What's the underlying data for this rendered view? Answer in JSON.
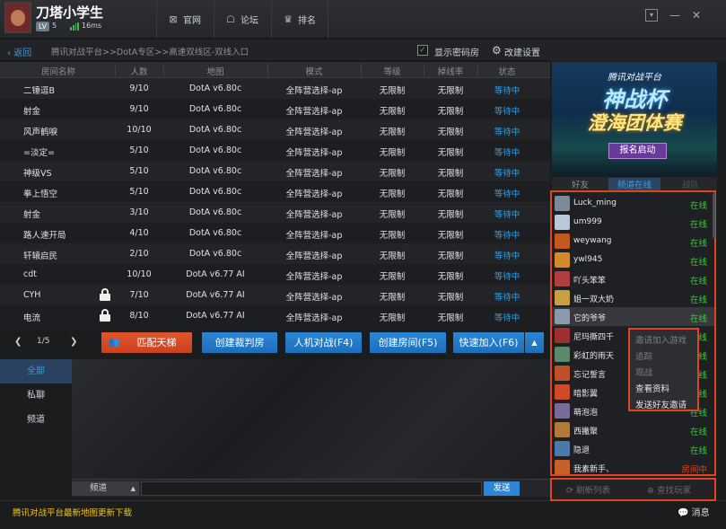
{
  "app": {
    "username": "刀塔小学生",
    "level_badge": "LV",
    "level": "5",
    "ping": "16ms",
    "nav": [
      "官网",
      "论坛",
      "排名"
    ]
  },
  "toolbar": {
    "back": "返回",
    "breadcrumb": "腾讯对战平台>>DotA专区>>高速双线区-双线入口",
    "show_password_rooms": "显示密码房",
    "edit_settings": "改建设置"
  },
  "table": {
    "headers": [
      "房间名称",
      "人数",
      "地图",
      "模式",
      "等级",
      "掉线率",
      "状态"
    ],
    "rows": [
      {
        "name": "二锤逗B",
        "count": "9/10",
        "map": "DotA v6.80c",
        "mode": "全阵营选择-ap",
        "level": "无限制",
        "drop": "无限制",
        "status": "等待中",
        "locked": false
      },
      {
        "name": "射金",
        "count": "9/10",
        "map": "DotA v6.80c",
        "mode": "全阵营选择-ap",
        "level": "无限制",
        "drop": "无限制",
        "status": "等待中",
        "locked": false
      },
      {
        "name": "风声鹤唳",
        "count": "10/10",
        "map": "DotA v6.80c",
        "mode": "全阵营选择-ap",
        "level": "无限制",
        "drop": "无限制",
        "status": "等待中",
        "locked": false
      },
      {
        "name": "=淡定=",
        "count": "5/10",
        "map": "DotA v6.80c",
        "mode": "全阵营选择-ap",
        "level": "无限制",
        "drop": "无限制",
        "status": "等待中",
        "locked": false
      },
      {
        "name": "神级VS",
        "count": "5/10",
        "map": "DotA v6.80c",
        "mode": "全阵营选择-ap",
        "level": "无限制",
        "drop": "无限制",
        "status": "等待中",
        "locked": false
      },
      {
        "name": "拳上悟空",
        "count": "5/10",
        "map": "DotA v6.80c",
        "mode": "全阵营选择-ap",
        "level": "无限制",
        "drop": "无限制",
        "status": "等待中",
        "locked": false
      },
      {
        "name": "射金",
        "count": "3/10",
        "map": "DotA v6.80c",
        "mode": "全阵营选择-ap",
        "level": "无限制",
        "drop": "无限制",
        "status": "等待中",
        "locked": false
      },
      {
        "name": "路人速开局",
        "count": "4/10",
        "map": "DotA v6.80c",
        "mode": "全阵营选择-ap",
        "level": "无限制",
        "drop": "无限制",
        "status": "等待中",
        "locked": false
      },
      {
        "name": "轩辕启民",
        "count": "2/10",
        "map": "DotA v6.80c",
        "mode": "全阵营选择-ap",
        "level": "无限制",
        "drop": "无限制",
        "status": "等待中",
        "locked": false
      },
      {
        "name": "cdt",
        "count": "10/10",
        "map": "DotA v6.77 AI",
        "mode": "全阵营选择-ap",
        "level": "无限制",
        "drop": "无限制",
        "status": "等待中",
        "locked": false
      },
      {
        "name": "CYH",
        "count": "7/10",
        "map": "DotA v6.77 AI",
        "mode": "全阵营选择-ap",
        "level": "无限制",
        "drop": "无限制",
        "status": "等待中",
        "locked": true
      },
      {
        "name": "电流",
        "count": "8/10",
        "map": "DotA v6.77 AI",
        "mode": "全阵营选择-ap",
        "level": "无限制",
        "drop": "无限制",
        "status": "等待中",
        "locked": true
      }
    ]
  },
  "pager": {
    "info": "1/5"
  },
  "actions": {
    "match_ladder": "匹配天梯",
    "create_referee": "创建裁判房",
    "vs_ai": "人机对战(F4)",
    "create_room": "创建房间(F5)",
    "quick_join": "快速加入(F6)"
  },
  "chat": {
    "tabs": [
      "全部",
      "私聊",
      "频道"
    ],
    "channel_select": "频道",
    "send": "发送"
  },
  "status": {
    "news": "腾讯对战平台最新地图更新下载",
    "messages": "消息"
  },
  "banner": {
    "line1": "腾讯对战平台",
    "line2": "神战杯",
    "line3": "澄海团体赛",
    "button": "报名启动"
  },
  "friends": {
    "tabs": [
      "好友",
      "频道在线",
      "战队"
    ],
    "list": [
      {
        "name": "Luck_ming",
        "status": "在线",
        "color": "#7a8a9a"
      },
      {
        "name": "um999",
        "status": "在线",
        "color": "#b8c8d8"
      },
      {
        "name": "weywang",
        "status": "在线",
        "color": "#c25a1e"
      },
      {
        "name": "ywl945",
        "status": "在线",
        "color": "#d08a2a"
      },
      {
        "name": "吖头笨笨",
        "status": "在线",
        "color": "#b04040"
      },
      {
        "name": "姐一双大奶",
        "status": "在线",
        "color": "#c8a040"
      },
      {
        "name": "它的爷爷",
        "status": "在线",
        "color": "#8a9aaa"
      },
      {
        "name": "尼玛撕四千",
        "status": "在线",
        "color": "#a03030"
      },
      {
        "name": "彩虹的雨天",
        "status": "在线",
        "color": "#5a8a6a"
      },
      {
        "name": "忘记誓言",
        "status": "在线",
        "color": "#c0502a"
      },
      {
        "name": "暗影翼",
        "status": "在线",
        "color": "#d04a2a"
      },
      {
        "name": "萌泡泡",
        "status": "在线",
        "color": "#7a6a9a"
      },
      {
        "name": "西撇聚",
        "status": "在线",
        "color": "#b07a3a"
      },
      {
        "name": "隐退",
        "status": "在线",
        "color": "#4a7aaa"
      },
      {
        "name": "我素新手、",
        "status": "房间中",
        "color": "#c8602a"
      }
    ],
    "context_menu": [
      "邀请加入游戏",
      "追踪",
      "观战",
      "查看资料",
      "发送好友邀请"
    ],
    "refresh": "刷新列表",
    "find": "查找玩家"
  }
}
